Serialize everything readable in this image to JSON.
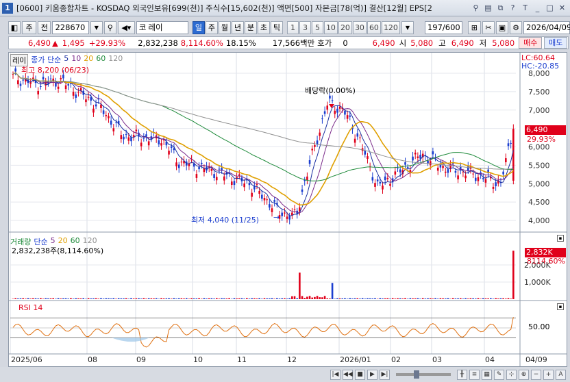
{
  "window": {
    "number": "1",
    "title": "[0600] 키움종합차트 - KOSDAQ 외국인보유[699(천)] 주식수[15,602(천)] 액면[500] 자본금[78(억)] 결산[12월] EPS[2"
  },
  "toolbar": {
    "market": "주",
    "period_btn": "전",
    "code": "228670",
    "market_tag": "코",
    "name": "레이",
    "periods": [
      "일",
      "주",
      "월",
      "년",
      "분",
      "초",
      "틱"
    ],
    "selected_period": "일",
    "minutes": [
      "1",
      "3",
      "5",
      "10",
      "20",
      "30",
      "60",
      "120"
    ],
    "count": "197",
    "count_total": "/600",
    "date": "2026/04/09"
  },
  "info": {
    "price": "6,490",
    "change": "1,495",
    "change_pct": "+29.93%",
    "volume": "2,832,238",
    "volume_pct": "8,114.60%",
    "turnover": "18.15%",
    "amount": "17,566백만",
    "hoga_label": "호가",
    "hoga": "0",
    "current": "6,490",
    "open_label": "시",
    "open": "5,080",
    "high_label": "고",
    "high": "6,490",
    "low_label": "저",
    "low": "5,080",
    "buy": "매수",
    "sell": "매도"
  },
  "legend": {
    "name": "레이",
    "ma_label": "종가 단순",
    "ma": [
      "5",
      "10",
      "20",
      "60",
      "120"
    ],
    "high_note": "최고 8,200 (06/23)",
    "low_note": "최저 4,040 (11/25)",
    "dividend": "배당락(0.00%)",
    "lc": "LC:60.64",
    "hc": "HC:-20.85",
    "price_badge": "6,490",
    "pct_badge": "29.93%"
  },
  "volume_panel": {
    "title": "거래량",
    "ma_label": "단순",
    "ma": [
      "5",
      "20",
      "60",
      "120"
    ],
    "value_text": "2,832,238주(8,114.60%)",
    "badge1": "2,832K",
    "badge2": "8114.60%"
  },
  "rsi_panel": {
    "title": "RSI 14",
    "level": "50.00"
  },
  "price_axis": [
    "8,000",
    "7,500",
    "7,000",
    "6,500",
    "6,000",
    "5,500",
    "5,000",
    "4,500",
    "4,000"
  ],
  "volume_axis": [
    "2,000K",
    "1,000K"
  ],
  "x_axis": [
    "2025/06",
    "08",
    "09",
    "10",
    "11",
    "12",
    "2026/01",
    "02",
    "03",
    "04",
    "04/09"
  ],
  "colors": {
    "up": "#e0001a",
    "down": "#1a3dcf",
    "ma5": "#1a2fa0",
    "ma10": "#7a2a8a",
    "ma20": "#e0a000",
    "ma60": "#1e8a3a",
    "ma120": "#909090",
    "rsi": "#e07010"
  }
}
